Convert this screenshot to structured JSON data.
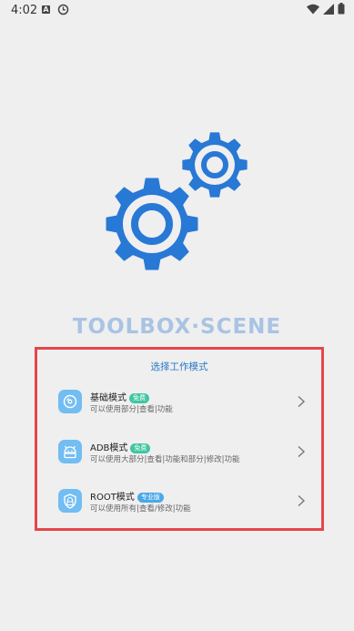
{
  "status_bar": {
    "time": "4:02",
    "notification_letter": "A",
    "icons": [
      "alarm-clock-icon",
      "wifi-icon",
      "signal-icon",
      "battery-icon"
    ]
  },
  "app": {
    "brand": "TOOLBOX·SCENE"
  },
  "mode_panel": {
    "title": "选择工作模式",
    "modes": [
      {
        "name": "基础模式",
        "badge": "免费",
        "badge_color": "#3fc6a2",
        "desc": "可以使用部分|查看|功能",
        "icon": "disc-icon"
      },
      {
        "name": "ADB模式",
        "badge": "免费",
        "badge_color": "#3fc6a2",
        "desc": "可以使用大部分|查看|功能和部分|修改|功能",
        "icon": "android-icon"
      },
      {
        "name": "ROOT模式",
        "badge": "专业版",
        "badge_color": "#4aa8e8",
        "desc": "可以使用所有|查看/修改|功能",
        "icon": "shield-icon"
      }
    ]
  },
  "colors": {
    "gear": "#2878d6",
    "brand_text": "#a9c3e4",
    "title_text": "#2979c9",
    "highlight_border": "#e6464a",
    "icon_bg": "#72bdf2"
  }
}
